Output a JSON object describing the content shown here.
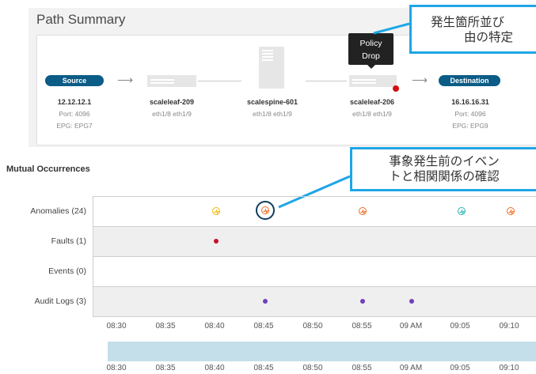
{
  "path_summary": {
    "title": "Path Summary",
    "tooltip": {
      "line1": "Policy",
      "line2": "Drop"
    },
    "nodes": [
      {
        "pill": "Source",
        "title": "12.12.12.1",
        "sub1": "Port: 4096",
        "sub2": "EPG: EPG7"
      },
      {
        "title": "scaleleaf-209",
        "sub1": "eth1/8 eth1/9"
      },
      {
        "title": "scalespine-601",
        "sub1": "eth1/8 eth1/9"
      },
      {
        "title": "scaleleaf-206",
        "sub1": "eth1/8 eth1/9"
      },
      {
        "pill": "Destination",
        "title": "16.16.16.31",
        "sub1": "Port: 4096",
        "sub2": "EPG: EPG9"
      }
    ]
  },
  "callouts": {
    "top": {
      "line1": "発生箇所並び",
      "line2": "由の特定"
    },
    "middle": {
      "line1": "事象発生前のイベン",
      "line2": "トと相関関係の確認"
    }
  },
  "mutual": {
    "title": "Mutual Occurrences",
    "rows": [
      "Anomalies (24)",
      "Faults (1)",
      "Events (0)",
      "Audit Logs (3)"
    ],
    "ticks": [
      "08:30",
      "08:35",
      "08:40",
      "08:45",
      "08:50",
      "08:55",
      "09 AM",
      "09:05",
      "09:10"
    ]
  },
  "colors": {
    "accent": "#0b5c86",
    "callout_border": "#1ea6e6",
    "fault": "#c8102e",
    "audit": "#6f3fbf",
    "anomaly_yellow": "#f5b50a",
    "anomaly_orange": "#f26b1d",
    "anomaly_teal": "#2bb3b1"
  }
}
